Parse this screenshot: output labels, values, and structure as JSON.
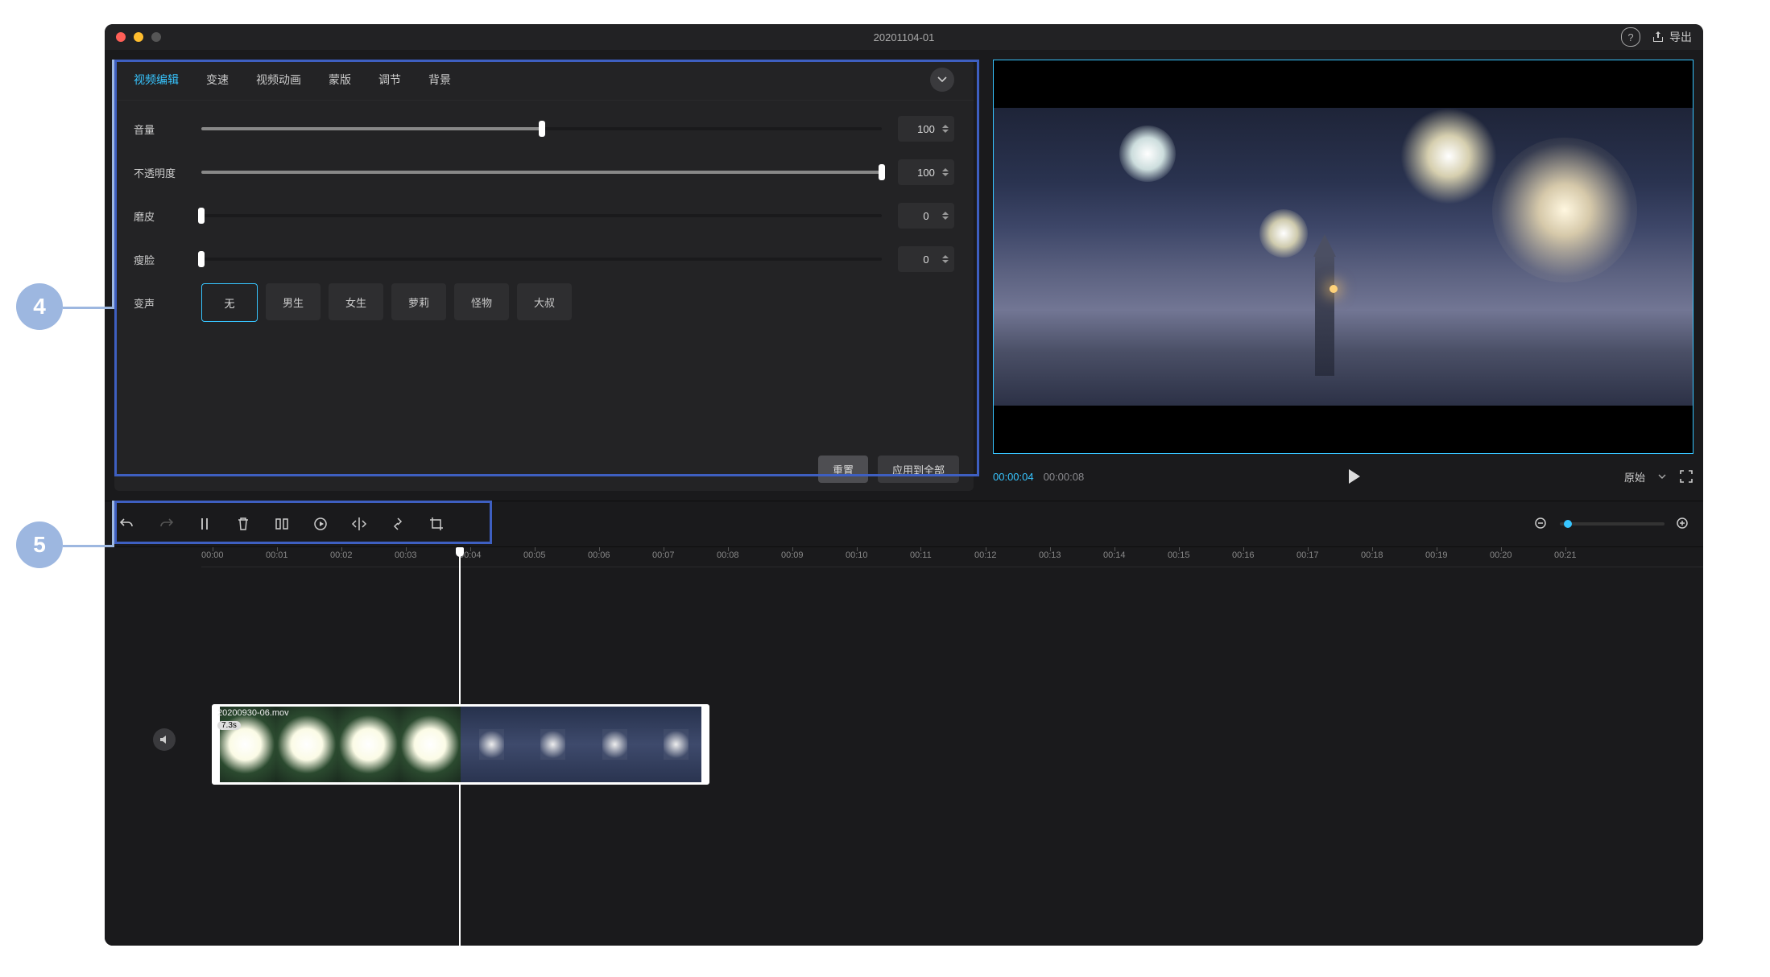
{
  "titlebar": {
    "project_name": "20201104-01",
    "export_label": "导出"
  },
  "tabs": [
    "视频编辑",
    "变速",
    "视频动画",
    "蒙版",
    "调节",
    "背景"
  ],
  "active_tab": 0,
  "sliders": {
    "volume": {
      "label": "音量",
      "value": 100,
      "display": "100",
      "pct": 50
    },
    "opacity": {
      "label": "不透明度",
      "value": 100,
      "display": "100",
      "pct": 100
    },
    "smooth": {
      "label": "磨皮",
      "value": 0,
      "display": "0",
      "pct": 0
    },
    "slim": {
      "label": "瘦脸",
      "value": 0,
      "display": "0",
      "pct": 0
    }
  },
  "voice": {
    "label": "变声",
    "options": [
      "无",
      "男生",
      "女生",
      "萝莉",
      "怪物",
      "大叔"
    ],
    "active": 0
  },
  "panel_buttons": {
    "reset": "重置",
    "apply_all": "应用到全部"
  },
  "preview": {
    "current": "00:00:04",
    "total": "00:00:08",
    "ratio": "原始"
  },
  "timeline": {
    "ticks": [
      "00:00",
      "00:01",
      "00:02",
      "00:03",
      "00:04",
      "00:05",
      "00:06",
      "00:07",
      "00:08",
      "00:09",
      "00:10",
      "00:11",
      "00:12",
      "00:13",
      "00:14",
      "00:15",
      "00:16",
      "00:17",
      "00:18",
      "00:19",
      "00:20",
      "00:21"
    ],
    "tick_spacing": 80,
    "playhead_sec": 4,
    "clip": {
      "name": "20200930-06.mov",
      "duration": "7.3s"
    }
  },
  "callouts": {
    "panel": "4",
    "tools": "5"
  },
  "colors": {
    "accent": "#37c5ff",
    "callout": "#9db7e0",
    "box": "#3e5fc1"
  }
}
